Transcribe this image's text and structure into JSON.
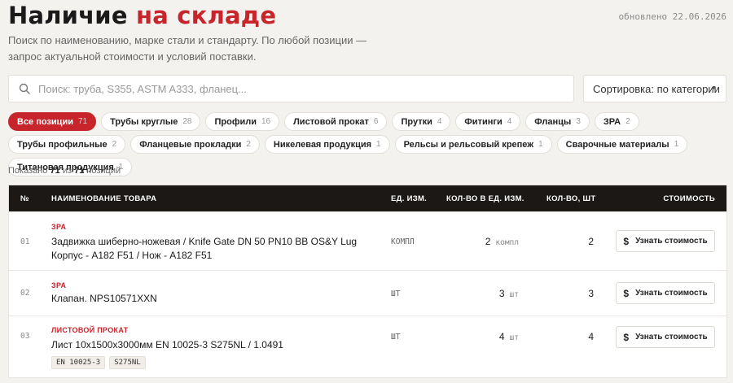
{
  "header": {
    "title_main": "Наличие",
    "title_accent": "на складе",
    "updated": "обновлено 22.06.2026",
    "subtitle": "Поиск по наименованию, марке стали и стандарту. По любой позиции — запрос актуальной стоимости и условий поставки."
  },
  "search": {
    "placeholder": "Поиск: труба, S355, ASTM A333, фланец...",
    "value": "",
    "icon": "search-icon"
  },
  "sort": {
    "label": "Сортировка: по категории",
    "icon": "chevron-down-icon"
  },
  "filters": [
    {
      "label": "Все позиции",
      "count": "71",
      "active": true
    },
    {
      "label": "Трубы круглые",
      "count": "28",
      "active": false
    },
    {
      "label": "Профили",
      "count": "16",
      "active": false
    },
    {
      "label": "Листовой прокат",
      "count": "6",
      "active": false
    },
    {
      "label": "Прутки",
      "count": "4",
      "active": false
    },
    {
      "label": "Фитинги",
      "count": "4",
      "active": false
    },
    {
      "label": "Фланцы",
      "count": "3",
      "active": false
    },
    {
      "label": "ЗРА",
      "count": "2",
      "active": false
    },
    {
      "label": "Трубы профильные",
      "count": "2",
      "active": false
    },
    {
      "label": "Фланцевые прокладки",
      "count": "2",
      "active": false
    },
    {
      "label": "Никелевая продукция",
      "count": "1",
      "active": false
    },
    {
      "label": "Рельсы и рельсовый крепеж",
      "count": "1",
      "active": false
    },
    {
      "label": "Сварочные материалы",
      "count": "1",
      "active": false
    },
    {
      "label": "Титановая продукция",
      "count": "1",
      "active": false
    }
  ],
  "results": {
    "prefix": "Показано",
    "shown": "71",
    "middle": "из",
    "total": "71",
    "suffix": "позиций"
  },
  "table": {
    "columns": {
      "num": "№",
      "name": "НАИМЕНОВАНИЕ ТОВАРА",
      "unit": "ЕД. ИЗМ.",
      "qty_unit": "КОЛ-ВО В ЕД. ИЗМ.",
      "qty_pcs": "КОЛ-ВО, ШТ",
      "price": "СТОИМОСТЬ"
    },
    "price_button": "Узнать стоимость",
    "price_icon": "dollar-icon",
    "rows": [
      {
        "num": "01",
        "category": "ЗРА",
        "name": "Задвижка шиберно-ножевая / Knife Gate DN 50 PN10 BB OS&Y Lug Корпус - A182 F51 / Нож - A182 F51",
        "unit": "КОМПЛ",
        "qty": "2",
        "qty_unit": "компл",
        "pcs": "2",
        "tags": []
      },
      {
        "num": "02",
        "category": "ЗРА",
        "name": "Клапан. NPS10571XXN",
        "unit": "ШТ",
        "qty": "3",
        "qty_unit": "шт",
        "pcs": "3",
        "tags": []
      },
      {
        "num": "03",
        "category": "ЛИСТОВОЙ ПРОКАТ",
        "name": "Лист 10х1500х3000мм EN 10025-3 S275NL / 1.0491",
        "unit": "ШТ",
        "qty": "4",
        "qty_unit": "шт",
        "pcs": "4",
        "tags": [
          "EN 10025-3",
          "S275NL"
        ]
      }
    ]
  }
}
